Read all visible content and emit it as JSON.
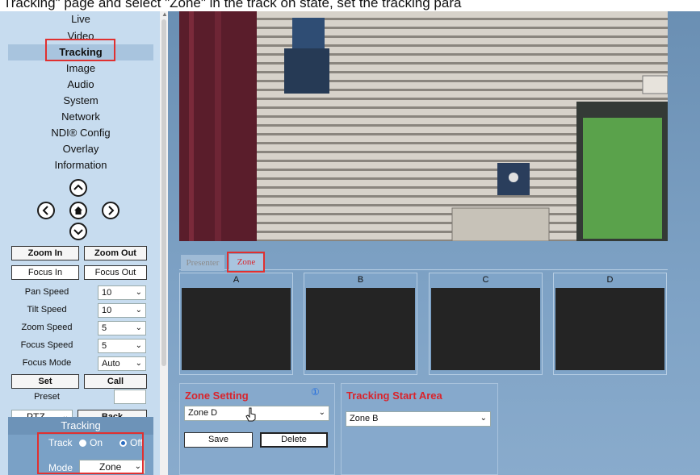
{
  "caption": "Tracking\" page and select \"Zone\" in the track on state, set the tracking para",
  "nav": {
    "items": [
      "Live",
      "Video",
      "Tracking",
      "Image",
      "Audio",
      "System",
      "Network",
      "NDI® Config",
      "Overlay",
      "Information"
    ],
    "active": "Tracking"
  },
  "ptz": {
    "icons": [
      "up-arrow-icon",
      "left-arrow-icon",
      "home-icon",
      "right-arrow-icon",
      "down-arrow-icon"
    ]
  },
  "controls": {
    "zoom_in": "Zoom In",
    "zoom_out": "Zoom Out",
    "focus_in": "Focus In",
    "focus_out": "Focus Out",
    "settings": [
      {
        "label": "Pan Speed",
        "value": "10"
      },
      {
        "label": "Tilt Speed",
        "value": "10"
      },
      {
        "label": "Zoom Speed",
        "value": "5"
      },
      {
        "label": "Focus Speed",
        "value": "5"
      },
      {
        "label": "Focus Mode",
        "value": "Auto"
      }
    ],
    "set": "Set",
    "call": "Call",
    "preset_label": "Preset",
    "preset_value": "",
    "mode_select": "PTZ",
    "back": "Back"
  },
  "tracking": {
    "header": "Tracking",
    "track_label": "Track",
    "on": "On",
    "off": "Off",
    "track_state": "Off",
    "mode_label": "Mode",
    "mode_value": "Zone"
  },
  "tabs": [
    "Presenter",
    "Zone"
  ],
  "active_tab": "Zone",
  "zones": [
    "A",
    "B",
    "C",
    "D"
  ],
  "zone_setting": {
    "title": "Zone Setting",
    "info_icon": "①",
    "selected": "Zone D",
    "save": "Save",
    "delete": "Delete"
  },
  "tracking_start": {
    "title": "Tracking Start Area",
    "selected": "Zone B"
  },
  "colors": {
    "accent_red": "#d9242c",
    "highlight": "#e03030",
    "sidebar": "#c7dcef",
    "main": "#7ea2c5"
  }
}
